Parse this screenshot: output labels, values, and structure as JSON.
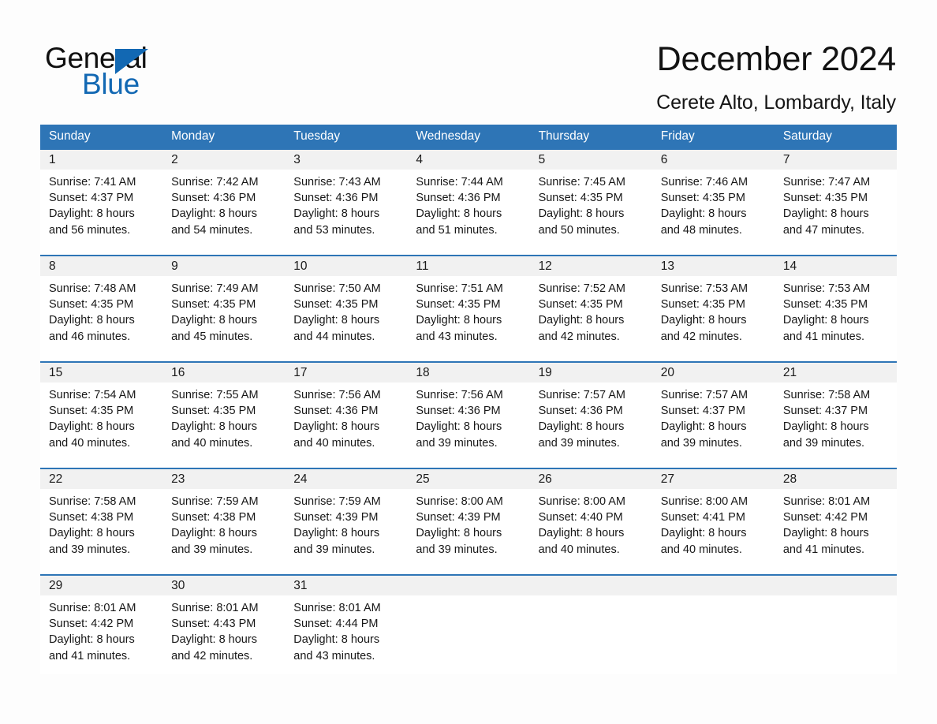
{
  "brand": {
    "name_part1": "General",
    "name_part2": "Blue",
    "triangle_icon": "triangle-icon",
    "accent_color": "#1268b3"
  },
  "header": {
    "title": "December 2024",
    "subtitle": "Cerete Alto, Lombardy, Italy"
  },
  "calendar": {
    "header_bg": "#2e75b6",
    "daynum_bg": "#f1f1f1",
    "weekdays": [
      "Sunday",
      "Monday",
      "Tuesday",
      "Wednesday",
      "Thursday",
      "Friday",
      "Saturday"
    ],
    "weeks": [
      {
        "days": [
          {
            "num": "1",
            "l1": "Sunrise: 7:41 AM",
            "l2": "Sunset: 4:37 PM",
            "l3": "Daylight: 8 hours",
            "l4": "and 56 minutes."
          },
          {
            "num": "2",
            "l1": "Sunrise: 7:42 AM",
            "l2": "Sunset: 4:36 PM",
            "l3": "Daylight: 8 hours",
            "l4": "and 54 minutes."
          },
          {
            "num": "3",
            "l1": "Sunrise: 7:43 AM",
            "l2": "Sunset: 4:36 PM",
            "l3": "Daylight: 8 hours",
            "l4": "and 53 minutes."
          },
          {
            "num": "4",
            "l1": "Sunrise: 7:44 AM",
            "l2": "Sunset: 4:36 PM",
            "l3": "Daylight: 8 hours",
            "l4": "and 51 minutes."
          },
          {
            "num": "5",
            "l1": "Sunrise: 7:45 AM",
            "l2": "Sunset: 4:35 PM",
            "l3": "Daylight: 8 hours",
            "l4": "and 50 minutes."
          },
          {
            "num": "6",
            "l1": "Sunrise: 7:46 AM",
            "l2": "Sunset: 4:35 PM",
            "l3": "Daylight: 8 hours",
            "l4": "and 48 minutes."
          },
          {
            "num": "7",
            "l1": "Sunrise: 7:47 AM",
            "l2": "Sunset: 4:35 PM",
            "l3": "Daylight: 8 hours",
            "l4": "and 47 minutes."
          }
        ]
      },
      {
        "days": [
          {
            "num": "8",
            "l1": "Sunrise: 7:48 AM",
            "l2": "Sunset: 4:35 PM",
            "l3": "Daylight: 8 hours",
            "l4": "and 46 minutes."
          },
          {
            "num": "9",
            "l1": "Sunrise: 7:49 AM",
            "l2": "Sunset: 4:35 PM",
            "l3": "Daylight: 8 hours",
            "l4": "and 45 minutes."
          },
          {
            "num": "10",
            "l1": "Sunrise: 7:50 AM",
            "l2": "Sunset: 4:35 PM",
            "l3": "Daylight: 8 hours",
            "l4": "and 44 minutes."
          },
          {
            "num": "11",
            "l1": "Sunrise: 7:51 AM",
            "l2": "Sunset: 4:35 PM",
            "l3": "Daylight: 8 hours",
            "l4": "and 43 minutes."
          },
          {
            "num": "12",
            "l1": "Sunrise: 7:52 AM",
            "l2": "Sunset: 4:35 PM",
            "l3": "Daylight: 8 hours",
            "l4": "and 42 minutes."
          },
          {
            "num": "13",
            "l1": "Sunrise: 7:53 AM",
            "l2": "Sunset: 4:35 PM",
            "l3": "Daylight: 8 hours",
            "l4": "and 42 minutes."
          },
          {
            "num": "14",
            "l1": "Sunrise: 7:53 AM",
            "l2": "Sunset: 4:35 PM",
            "l3": "Daylight: 8 hours",
            "l4": "and 41 minutes."
          }
        ]
      },
      {
        "days": [
          {
            "num": "15",
            "l1": "Sunrise: 7:54 AM",
            "l2": "Sunset: 4:35 PM",
            "l3": "Daylight: 8 hours",
            "l4": "and 40 minutes."
          },
          {
            "num": "16",
            "l1": "Sunrise: 7:55 AM",
            "l2": "Sunset: 4:35 PM",
            "l3": "Daylight: 8 hours",
            "l4": "and 40 minutes."
          },
          {
            "num": "17",
            "l1": "Sunrise: 7:56 AM",
            "l2": "Sunset: 4:36 PM",
            "l3": "Daylight: 8 hours",
            "l4": "and 40 minutes."
          },
          {
            "num": "18",
            "l1": "Sunrise: 7:56 AM",
            "l2": "Sunset: 4:36 PM",
            "l3": "Daylight: 8 hours",
            "l4": "and 39 minutes."
          },
          {
            "num": "19",
            "l1": "Sunrise: 7:57 AM",
            "l2": "Sunset: 4:36 PM",
            "l3": "Daylight: 8 hours",
            "l4": "and 39 minutes."
          },
          {
            "num": "20",
            "l1": "Sunrise: 7:57 AM",
            "l2": "Sunset: 4:37 PM",
            "l3": "Daylight: 8 hours",
            "l4": "and 39 minutes."
          },
          {
            "num": "21",
            "l1": "Sunrise: 7:58 AM",
            "l2": "Sunset: 4:37 PM",
            "l3": "Daylight: 8 hours",
            "l4": "and 39 minutes."
          }
        ]
      },
      {
        "days": [
          {
            "num": "22",
            "l1": "Sunrise: 7:58 AM",
            "l2": "Sunset: 4:38 PM",
            "l3": "Daylight: 8 hours",
            "l4": "and 39 minutes."
          },
          {
            "num": "23",
            "l1": "Sunrise: 7:59 AM",
            "l2": "Sunset: 4:38 PM",
            "l3": "Daylight: 8 hours",
            "l4": "and 39 minutes."
          },
          {
            "num": "24",
            "l1": "Sunrise: 7:59 AM",
            "l2": "Sunset: 4:39 PM",
            "l3": "Daylight: 8 hours",
            "l4": "and 39 minutes."
          },
          {
            "num": "25",
            "l1": "Sunrise: 8:00 AM",
            "l2": "Sunset: 4:39 PM",
            "l3": "Daylight: 8 hours",
            "l4": "and 39 minutes."
          },
          {
            "num": "26",
            "l1": "Sunrise: 8:00 AM",
            "l2": "Sunset: 4:40 PM",
            "l3": "Daylight: 8 hours",
            "l4": "and 40 minutes."
          },
          {
            "num": "27",
            "l1": "Sunrise: 8:00 AM",
            "l2": "Sunset: 4:41 PM",
            "l3": "Daylight: 8 hours",
            "l4": "and 40 minutes."
          },
          {
            "num": "28",
            "l1": "Sunrise: 8:01 AM",
            "l2": "Sunset: 4:42 PM",
            "l3": "Daylight: 8 hours",
            "l4": "and 41 minutes."
          }
        ]
      },
      {
        "days": [
          {
            "num": "29",
            "l1": "Sunrise: 8:01 AM",
            "l2": "Sunset: 4:42 PM",
            "l3": "Daylight: 8 hours",
            "l4": "and 41 minutes."
          },
          {
            "num": "30",
            "l1": "Sunrise: 8:01 AM",
            "l2": "Sunset: 4:43 PM",
            "l3": "Daylight: 8 hours",
            "l4": "and 42 minutes."
          },
          {
            "num": "31",
            "l1": "Sunrise: 8:01 AM",
            "l2": "Sunset: 4:44 PM",
            "l3": "Daylight: 8 hours",
            "l4": "and 43 minutes."
          },
          {
            "num": "",
            "l1": "",
            "l2": "",
            "l3": "",
            "l4": ""
          },
          {
            "num": "",
            "l1": "",
            "l2": "",
            "l3": "",
            "l4": ""
          },
          {
            "num": "",
            "l1": "",
            "l2": "",
            "l3": "",
            "l4": ""
          },
          {
            "num": "",
            "l1": "",
            "l2": "",
            "l3": "",
            "l4": ""
          }
        ]
      }
    ]
  }
}
